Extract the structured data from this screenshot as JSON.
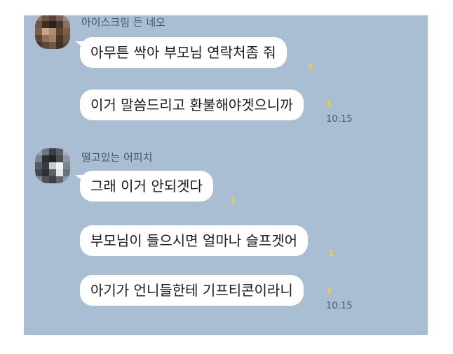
{
  "groups": [
    {
      "sender": "아이스크림 든 네오",
      "avatar_icon": "pixelated-profile-photo",
      "messages": [
        {
          "text": "아무튼 싹아 부모님 연락처좀 줘",
          "unread": "1",
          "time": ""
        },
        {
          "text": "이거 말씀드리고 환불해야겟으니까",
          "unread": "1",
          "time": "10:15"
        }
      ]
    },
    {
      "sender": "떨고있는 어피치",
      "avatar_icon": "pixelated-profile-photo",
      "messages": [
        {
          "text": "그래 이거 안되겟다",
          "unread": "1",
          "time": ""
        },
        {
          "text": "부모님이 들으시면 얼마나 슬프겟어",
          "unread": "1",
          "time": ""
        },
        {
          "text": "아기가 언니들한테 기프티콘이라니",
          "unread": "1",
          "time": "10:15"
        }
      ]
    }
  ],
  "colors": {
    "chat_background": "#a9bdd3",
    "bubble": "#ffffff",
    "unread_count": "#f2d229"
  }
}
